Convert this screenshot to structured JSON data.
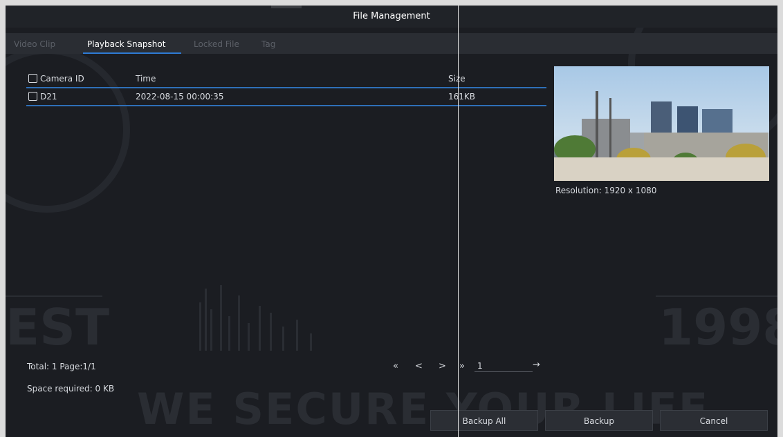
{
  "window": {
    "title": "File Management"
  },
  "tabs": [
    {
      "label": "Video Clip",
      "active": false
    },
    {
      "label": "Playback Snapshot",
      "active": true
    },
    {
      "label": "Locked File",
      "active": false
    },
    {
      "label": "Tag",
      "active": false
    }
  ],
  "table": {
    "headers": {
      "camera_id": "Camera ID",
      "time": "Time",
      "size": "Size"
    },
    "rows": [
      {
        "camera_id": "D21",
        "time": "2022-08-15 00:00:35",
        "size": "161KB",
        "checked": false
      }
    ]
  },
  "preview": {
    "resolution_label": "Resolution: 1920 x 1080"
  },
  "footer": {
    "total": "Total: 1  Page:1/1",
    "space_required": "Space required: 0 KB"
  },
  "pager": {
    "first": "«",
    "prev": "<",
    "next": ">",
    "last": "»",
    "page_value": "1",
    "go": "→"
  },
  "buttons": {
    "backup_all": "Backup All",
    "backup": "Backup",
    "cancel": "Cancel"
  },
  "watermark": {
    "slogan": "WE SECURE YOUR LIFE",
    "left_text": "EST",
    "right_text": "1998"
  },
  "colors": {
    "accent": "#2e7bd6",
    "background": "#1b1d22",
    "text": "#d8dbe0"
  }
}
